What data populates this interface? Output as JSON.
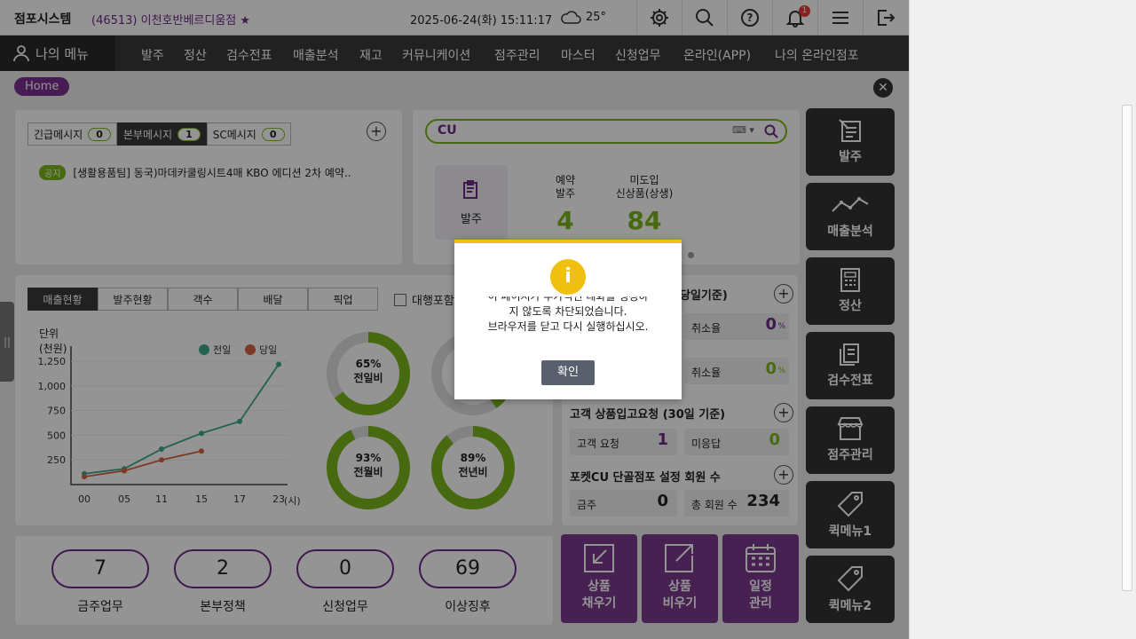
{
  "header": {
    "brand": "점포시스템",
    "store": "(46513) 이천호반베르디움점",
    "datetime": "2025-06-24(화) 15:11:17",
    "temperature": "25°",
    "notification_count": "1"
  },
  "nav": {
    "mymenu": "나의 메뉴",
    "items": [
      "발주",
      "정산",
      "검수전표",
      "매출분석",
      "재고",
      "커뮤니케이션",
      "점주관리",
      "마스터",
      "신청업무",
      "온라인(APP)",
      "나의 온라인점포"
    ]
  },
  "breadcrumb": "Home",
  "messages": {
    "tabs": [
      {
        "label": "긴급메시지",
        "count": "0"
      },
      {
        "label": "본부메시지",
        "count": "1"
      },
      {
        "label": "SC메시지",
        "count": "0"
      }
    ],
    "notice_tag": "공지",
    "notice_text": "[생활용품팀] 동국)마데카쿨링시트4매 KBO 에디션 2차 예약.."
  },
  "search": {
    "brand": "CU"
  },
  "order_summary": {
    "button_label": "발주",
    "reserved_label": "예약\n발주",
    "reserved_value": "4",
    "new_label": "미도입\n신상품(상생)",
    "new_value": "84"
  },
  "sales_tabs": [
    "매출현황",
    "발주현황",
    "객수",
    "배달",
    "픽업"
  ],
  "proxy_label": "대행포함",
  "chart_data": {
    "type": "line",
    "ylabel": "단위\n(천원)",
    "x": [
      "00",
      "05",
      "11",
      "15",
      "17",
      "23"
    ],
    "x_unit": "(시)",
    "yticks": [
      250,
      500,
      750,
      1000,
      1250
    ],
    "ylim": [
      0,
      1350
    ],
    "series": [
      {
        "name": "전일",
        "color": "#3fa88c",
        "values": [
          110,
          160,
          360,
          520,
          640,
          1220
        ]
      },
      {
        "name": "당일",
        "color": "#d9623f",
        "values": [
          80,
          140,
          250,
          340,
          null,
          null
        ]
      }
    ],
    "legend": "top-right"
  },
  "donuts": [
    {
      "pct": "65%",
      "label": "전일비",
      "value": 0.65
    },
    {
      "pct": "93%",
      "label": "전월비",
      "value": 0.93
    },
    {
      "pct": "89%",
      "label": "전년비",
      "value": 0.89
    }
  ],
  "right_stats": {
    "title_partial": "당일기준)",
    "cancel_label": "취소율",
    "cancel1": "0",
    "cancel2": "0",
    "pct": "%",
    "customer_title": "고객 상품입고요청 (30일 기준)",
    "customer_req_label": "고객 요청",
    "customer_req_value": "1",
    "unanswered_label": "미응답",
    "unanswered_value": "0",
    "pocket_title": "포켓CU 단골점포 설정 회원 수",
    "today_label": "금주",
    "today_value": "0",
    "total_label": "총 회원 수",
    "total_value": "234"
  },
  "bubbles": [
    {
      "value": "7",
      "label": "금주업무"
    },
    {
      "value": "2",
      "label": "본부정책"
    },
    {
      "value": "0",
      "label": "신청업무"
    },
    {
      "value": "69",
      "label": "이상징후"
    }
  ],
  "big_buttons": [
    {
      "line1": "상품",
      "line2": "채우기"
    },
    {
      "line1": "상품",
      "line2": "비우기"
    },
    {
      "line1": "일정",
      "line2": "관리"
    }
  ],
  "side_buttons": [
    "발주",
    "매출분석",
    "정산",
    "검수전표",
    "점주관리",
    "퀵메뉴1",
    "퀵메뉴2"
  ],
  "dialog": {
    "partial_line": "이 페이지가 추가적인 대화를 생성하",
    "line2": "지 않도록 차단되었습니다.",
    "line3": "브라우저를 닫고 다시 실행하십시오.",
    "ok": "확인"
  }
}
